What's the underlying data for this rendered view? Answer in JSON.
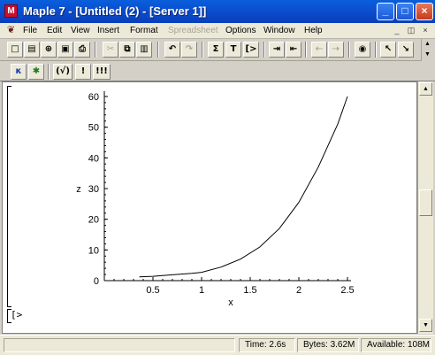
{
  "window": {
    "title": "Maple 7  - [Untitled (2) - [Server 1]]",
    "minimize_glyph": "_",
    "maximize_glyph": "□",
    "close_glyph": "×",
    "app_icon_glyph": "M"
  },
  "menubar": {
    "items": [
      "File",
      "Edit",
      "View",
      "Insert",
      "Format",
      "Spreadsheet",
      "Options",
      "Window",
      "Help"
    ],
    "disabled": [
      "Spreadsheet"
    ],
    "mdi": [
      "_",
      "◫",
      "×"
    ]
  },
  "toolbar1": {
    "buttons": [
      {
        "name": "new-file",
        "glyph": "□"
      },
      {
        "name": "open-file",
        "glyph": "▤"
      },
      {
        "name": "open-url",
        "glyph": "⊕"
      },
      {
        "name": "save",
        "glyph": "▣"
      },
      {
        "name": "print",
        "glyph": "⎙"
      },
      {
        "name": "cut",
        "glyph": "✂"
      },
      {
        "name": "copy",
        "glyph": "⧉"
      },
      {
        "name": "paste",
        "glyph": "▥"
      },
      {
        "name": "undo",
        "glyph": "↶"
      },
      {
        "name": "redo",
        "glyph": "↷"
      },
      {
        "name": "sum",
        "glyph": "Σ"
      },
      {
        "name": "text",
        "glyph": "T"
      },
      {
        "name": "insert-input",
        "glyph": "[>"
      },
      {
        "name": "indent",
        "glyph": "⇥"
      },
      {
        "name": "outdent",
        "glyph": "⇤"
      },
      {
        "name": "back",
        "glyph": "⇠"
      },
      {
        "name": "forward",
        "glyph": "⇢"
      },
      {
        "name": "stop",
        "glyph": "◉"
      },
      {
        "name": "zoom-in",
        "glyph": "↖"
      },
      {
        "name": "zoom-out",
        "glyph": "↘"
      }
    ]
  },
  "toolbar2": {
    "buttons": [
      {
        "name": "kernel",
        "glyph": "κ"
      },
      {
        "name": "debug",
        "glyph": "✱"
      },
      {
        "name": "evaluate-checked",
        "glyph": "(√)"
      },
      {
        "name": "execute",
        "glyph": "!"
      },
      {
        "name": "execute-all",
        "glyph": "!!!"
      }
    ]
  },
  "document": {
    "prompt": "[>"
  },
  "statusbar": {
    "time": "Time:  2.6s",
    "bytes": "Bytes: 3.62M",
    "available": "Available: 108M"
  },
  "colors": {
    "titlebar": "#0b49c9",
    "curve": "#000000"
  },
  "chart_data": {
    "type": "line",
    "title": "",
    "xlabel": "x",
    "ylabel": "z",
    "xlim": [
      0,
      2.5
    ],
    "ylim": [
      0,
      60
    ],
    "xticks": [
      "0.5",
      "1",
      "1.5",
      "2",
      "2.5"
    ],
    "yticks": [
      "0",
      "10",
      "20",
      "30",
      "40",
      "50",
      "60"
    ],
    "grid": false,
    "series": [
      {
        "x": [
          0.36,
          0.5,
          0.7,
          0.9,
          1.0,
          1.2,
          1.4,
          1.6,
          1.8,
          2.0,
          2.2,
          2.4,
          2.5
        ],
        "values": [
          1.2,
          1.4,
          1.9,
          2.4,
          2.7,
          4.4,
          7.0,
          11.0,
          17.0,
          25.5,
          37.0,
          51.0,
          60.0
        ]
      }
    ]
  }
}
